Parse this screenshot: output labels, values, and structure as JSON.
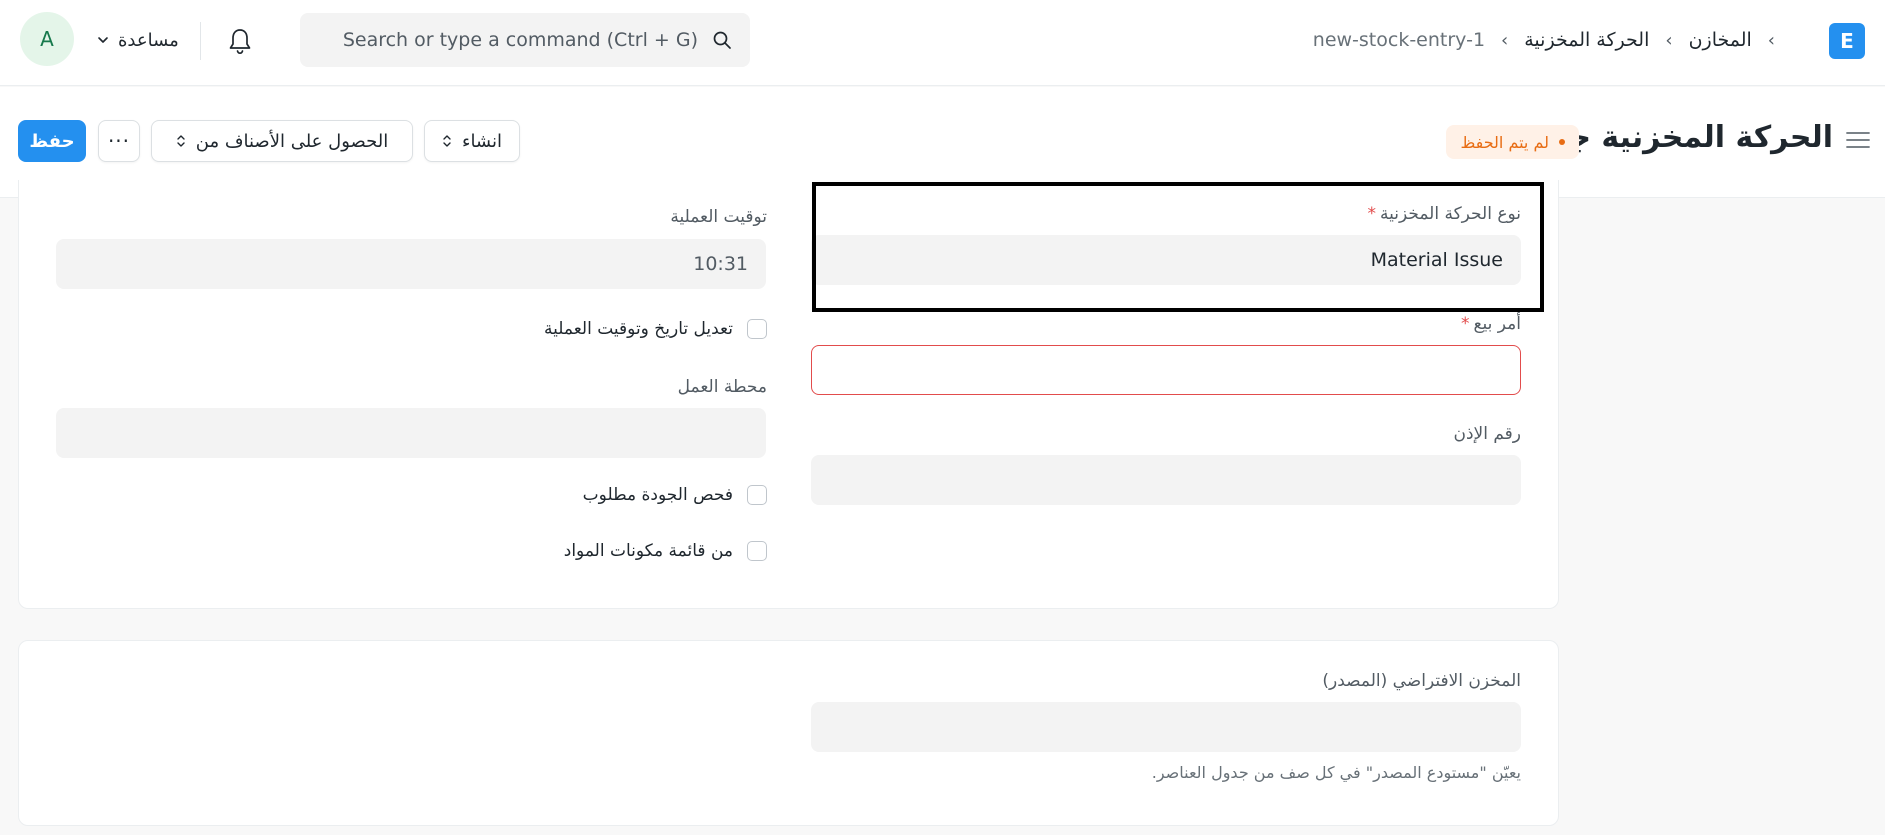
{
  "navbar": {
    "avatar_initial": "A",
    "help_label": "مساعدة",
    "search_placeholder": "Search or type a command (Ctrl + G)",
    "breadcrumbs": [
      "المخازن",
      "الحركة المخزنية",
      "new-stock-entry-1"
    ],
    "logo_letter": "E"
  },
  "page_head": {
    "title": "الحركة المخزنية جديد",
    "status_indicator": "لم يتم الحفظ",
    "save_label": "حفظ",
    "more_label": "···",
    "get_items_label": "الحصول على الأصناف من",
    "create_label": "انشاء"
  },
  "form": {
    "stock_entry_type": {
      "label": "نوع الحركة المخزنية",
      "required": "*",
      "value": "Material Issue"
    },
    "sales_order": {
      "label": "أمر بيع",
      "required": "*",
      "value": ""
    },
    "permit_no": {
      "label": "رقم الإذن",
      "value": ""
    },
    "posting_time": {
      "label": "توقيت العملية",
      "value": "10:31"
    },
    "edit_posting": {
      "label": "تعديل تاريخ وتوقيت العملية"
    },
    "workstation": {
      "label": "محطة العمل",
      "value": ""
    },
    "inspection_required": {
      "label": "فحص الجودة مطلوب"
    },
    "from_bom": {
      "label": "من قائمة مكونات المواد"
    }
  },
  "section2": {
    "default_source_warehouse": {
      "label": "المخزن الافتراضي (المصدر)",
      "value": "",
      "help": "يعيّن \"مستودع المصدر\" في كل صف من جدول العناصر."
    }
  },
  "colors": {
    "primary": "#2490ef",
    "indicator_text": "#e86c13",
    "indicator_bg": "#fff1e7",
    "error": "#e24c4c",
    "avatar_bg": "#e4f5e9",
    "avatar_text": "#16794c"
  },
  "icons": {
    "logo": "app-logo-icon",
    "bell": "bell-icon",
    "search": "search-icon",
    "chevron": "chevron-down-icon",
    "menu": "hamburger-icon",
    "updown": "updown-icon"
  }
}
